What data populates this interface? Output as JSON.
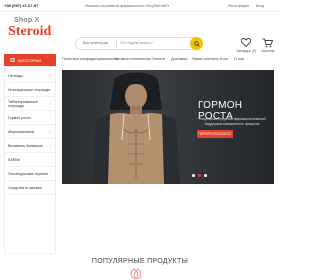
{
  "topbar": {
    "phone": "+38 (097) 47-67-97",
    "notice": "Магазин спортивной фармакологии ShopSteroidEx",
    "register": "Регистрация",
    "login": "Вход"
  },
  "logo": {
    "line1": "Shop X",
    "line2": "Steroid"
  },
  "search": {
    "category": "Все категории",
    "placeholder": "Что будем искать?"
  },
  "header_icons": {
    "favorites": "Закладки (0)",
    "cart": "Корзина"
  },
  "nav": {
    "categories_label": "КАТЕГОРИИ",
    "items": [
      "Политика конфиденциальности",
      "Условия соглашения",
      "Оплата",
      "Доставка",
      "Наши контакты",
      "Блог",
      "О нас"
    ]
  },
  "sidebar": {
    "items": [
      "Пептиды",
      "Инъекционные стероиды",
      "Таблетированные стероиды",
      "Гормон роста",
      "Жиросжигатели",
      "Витамины Кревалью",
      "SARMs",
      "Послекурсовая терапия",
      "Средства от увлажи"
    ]
  },
  "banner": {
    "title": "ГОРМОН РОСТА",
    "subtitle": "Популярное средство фармакологической поддержки повышенного процесса",
    "cta": "ПЕРЕЙТИ В КАТАЛОГ"
  },
  "popular": {
    "title": "ПОПУЛЯРНЫЕ ПРОДУКТЫ"
  },
  "colors": {
    "accent": "#e4432a",
    "search_button": "#f0c400",
    "banner_dark": "#2a2d30"
  }
}
